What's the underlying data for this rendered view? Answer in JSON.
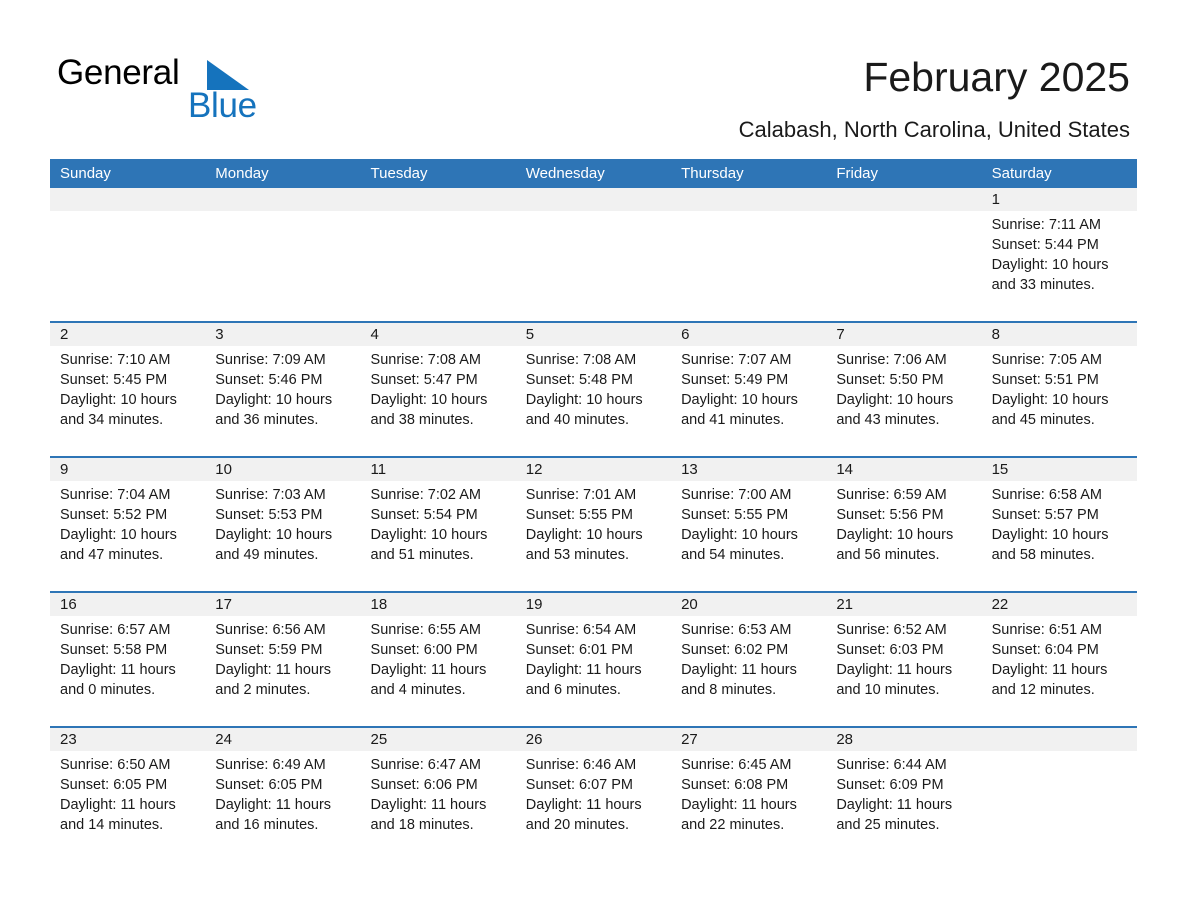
{
  "brand": {
    "name_part1": "General",
    "name_part2": "Blue",
    "triangle_color": "#1573bd"
  },
  "header": {
    "title": "February 2025",
    "subtitle": "Calabash, North Carolina, United States"
  },
  "theme": {
    "accent": "#2e75b6",
    "date_band": "#f1f1f1",
    "text": "#1a1a1a",
    "header_text": "#ffffff"
  },
  "weekday_headers": [
    "Sunday",
    "Monday",
    "Tuesday",
    "Wednesday",
    "Thursday",
    "Friday",
    "Saturday"
  ],
  "labels": {
    "sunrise_prefix": "Sunrise:",
    "sunset_prefix": "Sunset:",
    "daylight_prefix": "Daylight:"
  },
  "weeks": [
    [
      {
        "empty": true
      },
      {
        "empty": true
      },
      {
        "empty": true
      },
      {
        "empty": true
      },
      {
        "empty": true
      },
      {
        "empty": true
      },
      {
        "day": "1",
        "sunrise": "Sunrise: 7:11 AM",
        "sunset": "Sunset: 5:44 PM",
        "daylight": "Daylight: 10 hours and 33 minutes."
      }
    ],
    [
      {
        "day": "2",
        "sunrise": "Sunrise: 7:10 AM",
        "sunset": "Sunset: 5:45 PM",
        "daylight": "Daylight: 10 hours and 34 minutes."
      },
      {
        "day": "3",
        "sunrise": "Sunrise: 7:09 AM",
        "sunset": "Sunset: 5:46 PM",
        "daylight": "Daylight: 10 hours and 36 minutes."
      },
      {
        "day": "4",
        "sunrise": "Sunrise: 7:08 AM",
        "sunset": "Sunset: 5:47 PM",
        "daylight": "Daylight: 10 hours and 38 minutes."
      },
      {
        "day": "5",
        "sunrise": "Sunrise: 7:08 AM",
        "sunset": "Sunset: 5:48 PM",
        "daylight": "Daylight: 10 hours and 40 minutes."
      },
      {
        "day": "6",
        "sunrise": "Sunrise: 7:07 AM",
        "sunset": "Sunset: 5:49 PM",
        "daylight": "Daylight: 10 hours and 41 minutes."
      },
      {
        "day": "7",
        "sunrise": "Sunrise: 7:06 AM",
        "sunset": "Sunset: 5:50 PM",
        "daylight": "Daylight: 10 hours and 43 minutes."
      },
      {
        "day": "8",
        "sunrise": "Sunrise: 7:05 AM",
        "sunset": "Sunset: 5:51 PM",
        "daylight": "Daylight: 10 hours and 45 minutes."
      }
    ],
    [
      {
        "day": "9",
        "sunrise": "Sunrise: 7:04 AM",
        "sunset": "Sunset: 5:52 PM",
        "daylight": "Daylight: 10 hours and 47 minutes."
      },
      {
        "day": "10",
        "sunrise": "Sunrise: 7:03 AM",
        "sunset": "Sunset: 5:53 PM",
        "daylight": "Daylight: 10 hours and 49 minutes."
      },
      {
        "day": "11",
        "sunrise": "Sunrise: 7:02 AM",
        "sunset": "Sunset: 5:54 PM",
        "daylight": "Daylight: 10 hours and 51 minutes."
      },
      {
        "day": "12",
        "sunrise": "Sunrise: 7:01 AM",
        "sunset": "Sunset: 5:55 PM",
        "daylight": "Daylight: 10 hours and 53 minutes."
      },
      {
        "day": "13",
        "sunrise": "Sunrise: 7:00 AM",
        "sunset": "Sunset: 5:55 PM",
        "daylight": "Daylight: 10 hours and 54 minutes."
      },
      {
        "day": "14",
        "sunrise": "Sunrise: 6:59 AM",
        "sunset": "Sunset: 5:56 PM",
        "daylight": "Daylight: 10 hours and 56 minutes."
      },
      {
        "day": "15",
        "sunrise": "Sunrise: 6:58 AM",
        "sunset": "Sunset: 5:57 PM",
        "daylight": "Daylight: 10 hours and 58 minutes."
      }
    ],
    [
      {
        "day": "16",
        "sunrise": "Sunrise: 6:57 AM",
        "sunset": "Sunset: 5:58 PM",
        "daylight": "Daylight: 11 hours and 0 minutes."
      },
      {
        "day": "17",
        "sunrise": "Sunrise: 6:56 AM",
        "sunset": "Sunset: 5:59 PM",
        "daylight": "Daylight: 11 hours and 2 minutes."
      },
      {
        "day": "18",
        "sunrise": "Sunrise: 6:55 AM",
        "sunset": "Sunset: 6:00 PM",
        "daylight": "Daylight: 11 hours and 4 minutes."
      },
      {
        "day": "19",
        "sunrise": "Sunrise: 6:54 AM",
        "sunset": "Sunset: 6:01 PM",
        "daylight": "Daylight: 11 hours and 6 minutes."
      },
      {
        "day": "20",
        "sunrise": "Sunrise: 6:53 AM",
        "sunset": "Sunset: 6:02 PM",
        "daylight": "Daylight: 11 hours and 8 minutes."
      },
      {
        "day": "21",
        "sunrise": "Sunrise: 6:52 AM",
        "sunset": "Sunset: 6:03 PM",
        "daylight": "Daylight: 11 hours and 10 minutes."
      },
      {
        "day": "22",
        "sunrise": "Sunrise: 6:51 AM",
        "sunset": "Sunset: 6:04 PM",
        "daylight": "Daylight: 11 hours and 12 minutes."
      }
    ],
    [
      {
        "day": "23",
        "sunrise": "Sunrise: 6:50 AM",
        "sunset": "Sunset: 6:05 PM",
        "daylight": "Daylight: 11 hours and 14 minutes."
      },
      {
        "day": "24",
        "sunrise": "Sunrise: 6:49 AM",
        "sunset": "Sunset: 6:05 PM",
        "daylight": "Daylight: 11 hours and 16 minutes."
      },
      {
        "day": "25",
        "sunrise": "Sunrise: 6:47 AM",
        "sunset": "Sunset: 6:06 PM",
        "daylight": "Daylight: 11 hours and 18 minutes."
      },
      {
        "day": "26",
        "sunrise": "Sunrise: 6:46 AM",
        "sunset": "Sunset: 6:07 PM",
        "daylight": "Daylight: 11 hours and 20 minutes."
      },
      {
        "day": "27",
        "sunrise": "Sunrise: 6:45 AM",
        "sunset": "Sunset: 6:08 PM",
        "daylight": "Daylight: 11 hours and 22 minutes."
      },
      {
        "day": "28",
        "sunrise": "Sunrise: 6:44 AM",
        "sunset": "Sunset: 6:09 PM",
        "daylight": "Daylight: 11 hours and 25 minutes."
      },
      {
        "empty": true
      }
    ]
  ]
}
